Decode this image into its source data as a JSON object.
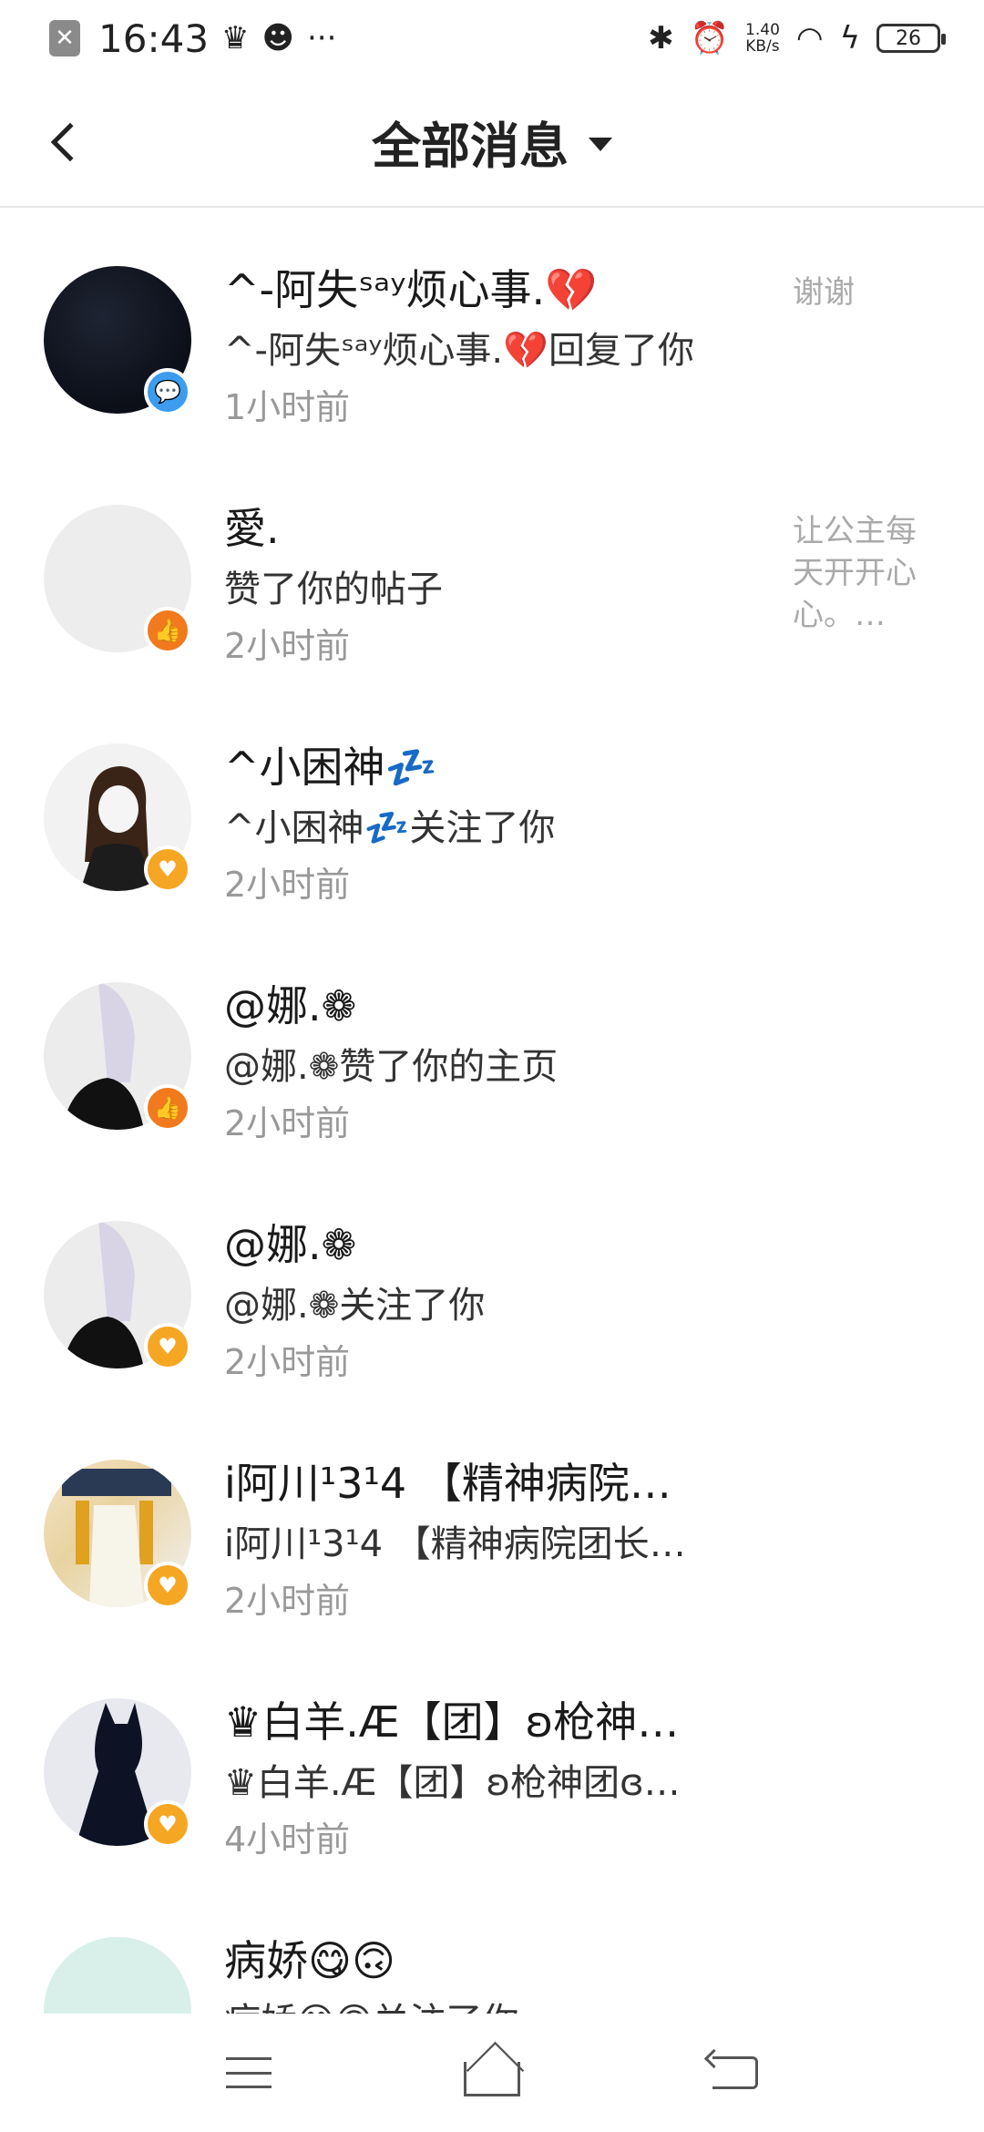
{
  "status_bar": {
    "time": "16:43",
    "icons": [
      "crown-icon",
      "cat-icon"
    ],
    "more": "···",
    "speed_top": "1.40",
    "speed_bottom": "KB/s",
    "battery": "26"
  },
  "header": {
    "title": "全部消息"
  },
  "messages": [
    {
      "name": "^-阿失ˢᵃʸ烦心事.💔",
      "action": "^-阿失ˢᵃʸ烦心事.💔回复了你",
      "time": "1小时前",
      "preview": "谢谢",
      "badge": "reply"
    },
    {
      "name": "愛.",
      "action": "赞了你的帖子",
      "time": "2小时前",
      "preview": "让公主每天开开心心。…",
      "badge": "like"
    },
    {
      "name": "^小困神💤",
      "action": "^小困神💤关注了你",
      "time": "2小时前",
      "preview": "",
      "badge": "follow"
    },
    {
      "name": "@娜.❁",
      "action": "@娜.❁赞了你的主页",
      "time": "2小时前",
      "preview": "",
      "badge": "like"
    },
    {
      "name": "@娜.❁",
      "action": "@娜.❁关注了你",
      "time": "2小时前",
      "preview": "",
      "badge": "follow"
    },
    {
      "name": "i阿川¹3¹4 【精神病院…",
      "action": "i阿川¹3¹4 【精神病院团长…",
      "time": "2小时前",
      "preview": "",
      "badge": "follow"
    },
    {
      "name": "♛白羊.Æ【团】ʚ枪神…",
      "action": "♛白羊.Æ【团】ʚ枪神团ɞ…",
      "time": "4小时前",
      "preview": "",
      "badge": "follow"
    },
    {
      "name": "病娇😋🙃",
      "action": "病娇😋🙃关注了你",
      "time": "",
      "preview": "",
      "badge": "follow"
    }
  ],
  "icons": {
    "reply": "💬",
    "like": "👍",
    "follow": "♥"
  }
}
